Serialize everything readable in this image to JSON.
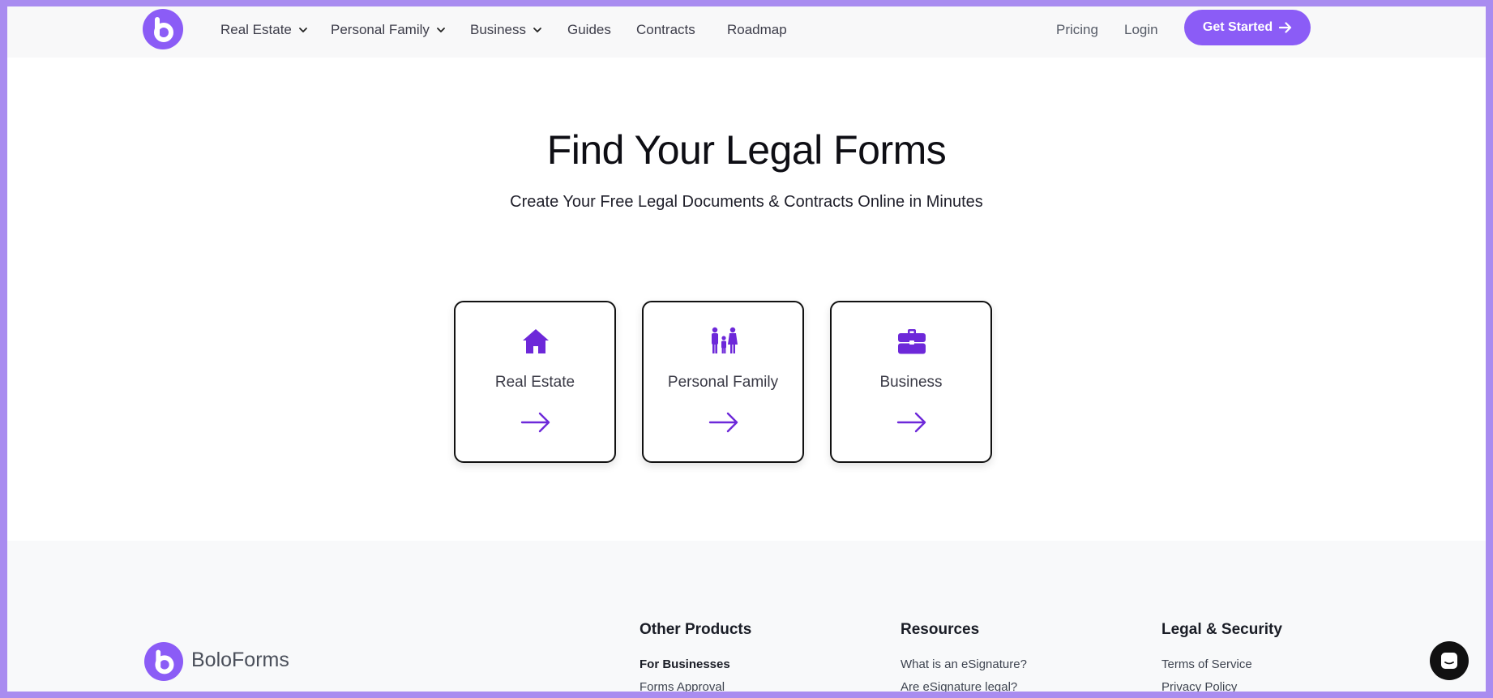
{
  "header": {
    "nav": [
      {
        "label": "Real Estate",
        "dropdown": true
      },
      {
        "label": "Personal Family",
        "dropdown": true
      },
      {
        "label": "Business",
        "dropdown": true
      },
      {
        "label": "Guides",
        "dropdown": false
      },
      {
        "label": "Contracts",
        "dropdown": false
      },
      {
        "label": "Roadmap",
        "dropdown": false
      }
    ],
    "pricing": "Pricing",
    "login": "Login",
    "cta": "Get Started"
  },
  "hero": {
    "title": "Find Your Legal Forms",
    "subtitle": "Create Your Free Legal Documents & Contracts Online in Minutes"
  },
  "categories": [
    {
      "label": "Real Estate",
      "icon": "house-icon"
    },
    {
      "label": "Personal Family",
      "icon": "family-icon"
    },
    {
      "label": "Business",
      "icon": "briefcase-icon"
    }
  ],
  "footer": {
    "brand": "BoloForms",
    "columns": [
      {
        "heading": "Other Products",
        "links": [
          "For Businesses",
          "Forms Approval"
        ]
      },
      {
        "heading": "Resources",
        "links": [
          "What is an eSignature?",
          "Are eSignature legal?"
        ]
      },
      {
        "heading": "Legal & Security",
        "links": [
          "Terms of Service",
          "Privacy Policy"
        ]
      }
    ]
  },
  "colors": {
    "brand": "#8b5cf6",
    "icon": "#6d28d9",
    "frame": "#a98cf0"
  }
}
